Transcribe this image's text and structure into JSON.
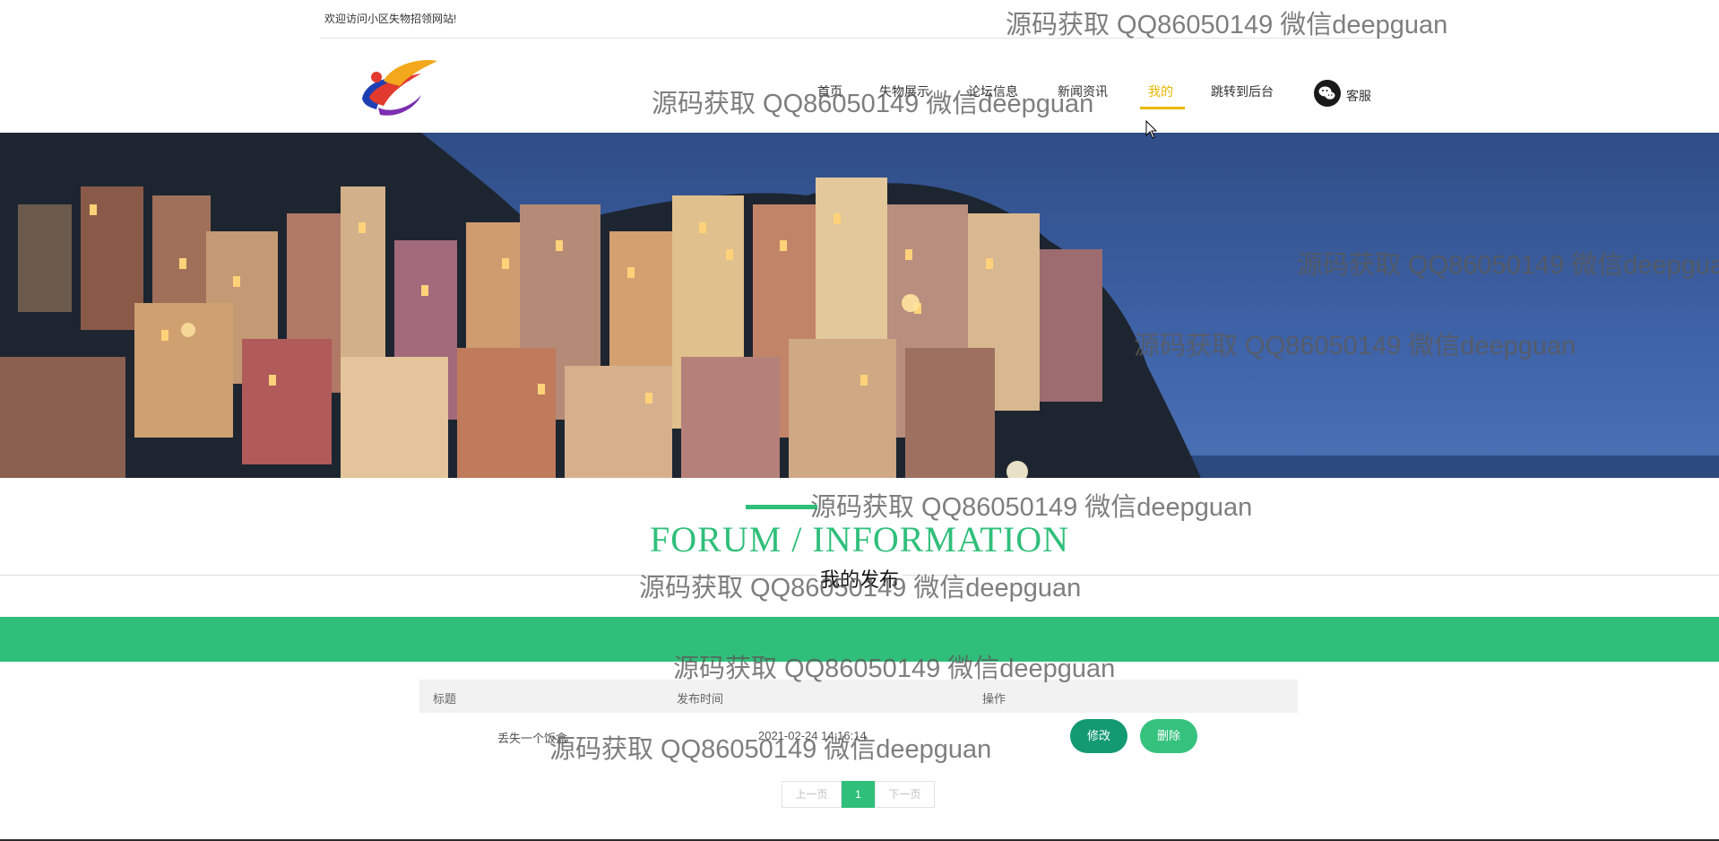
{
  "topbar": {
    "welcome": "欢迎访问小区失物招领网站!"
  },
  "nav": {
    "items": [
      {
        "label": "首页"
      },
      {
        "label": "失物展示"
      },
      {
        "label": "论坛信息"
      },
      {
        "label": "新闻资讯"
      },
      {
        "label": "我的"
      },
      {
        "label": "跳转到后台"
      }
    ],
    "active": "我的",
    "service": "客服"
  },
  "section": {
    "title_en": "FORUM / INFORMATION",
    "title_cn": "我的发布"
  },
  "table": {
    "headers": [
      "标题",
      "发布时间",
      "操作"
    ],
    "rows": [
      {
        "title": "丢失一个饭盒",
        "time": "2021-02-24 14:16:14",
        "edit": "修改",
        "delete": "删除"
      }
    ]
  },
  "pagination": {
    "prev": "上一页",
    "current": "1",
    "next": "下一页"
  },
  "watermark": "源码获取 QQ86050149 微信deepguan",
  "colors": {
    "accent": "#2fbf7a",
    "nav_active": "#e8b800",
    "edit_button": "#139a73",
    "delete_button": "#35c27d"
  }
}
